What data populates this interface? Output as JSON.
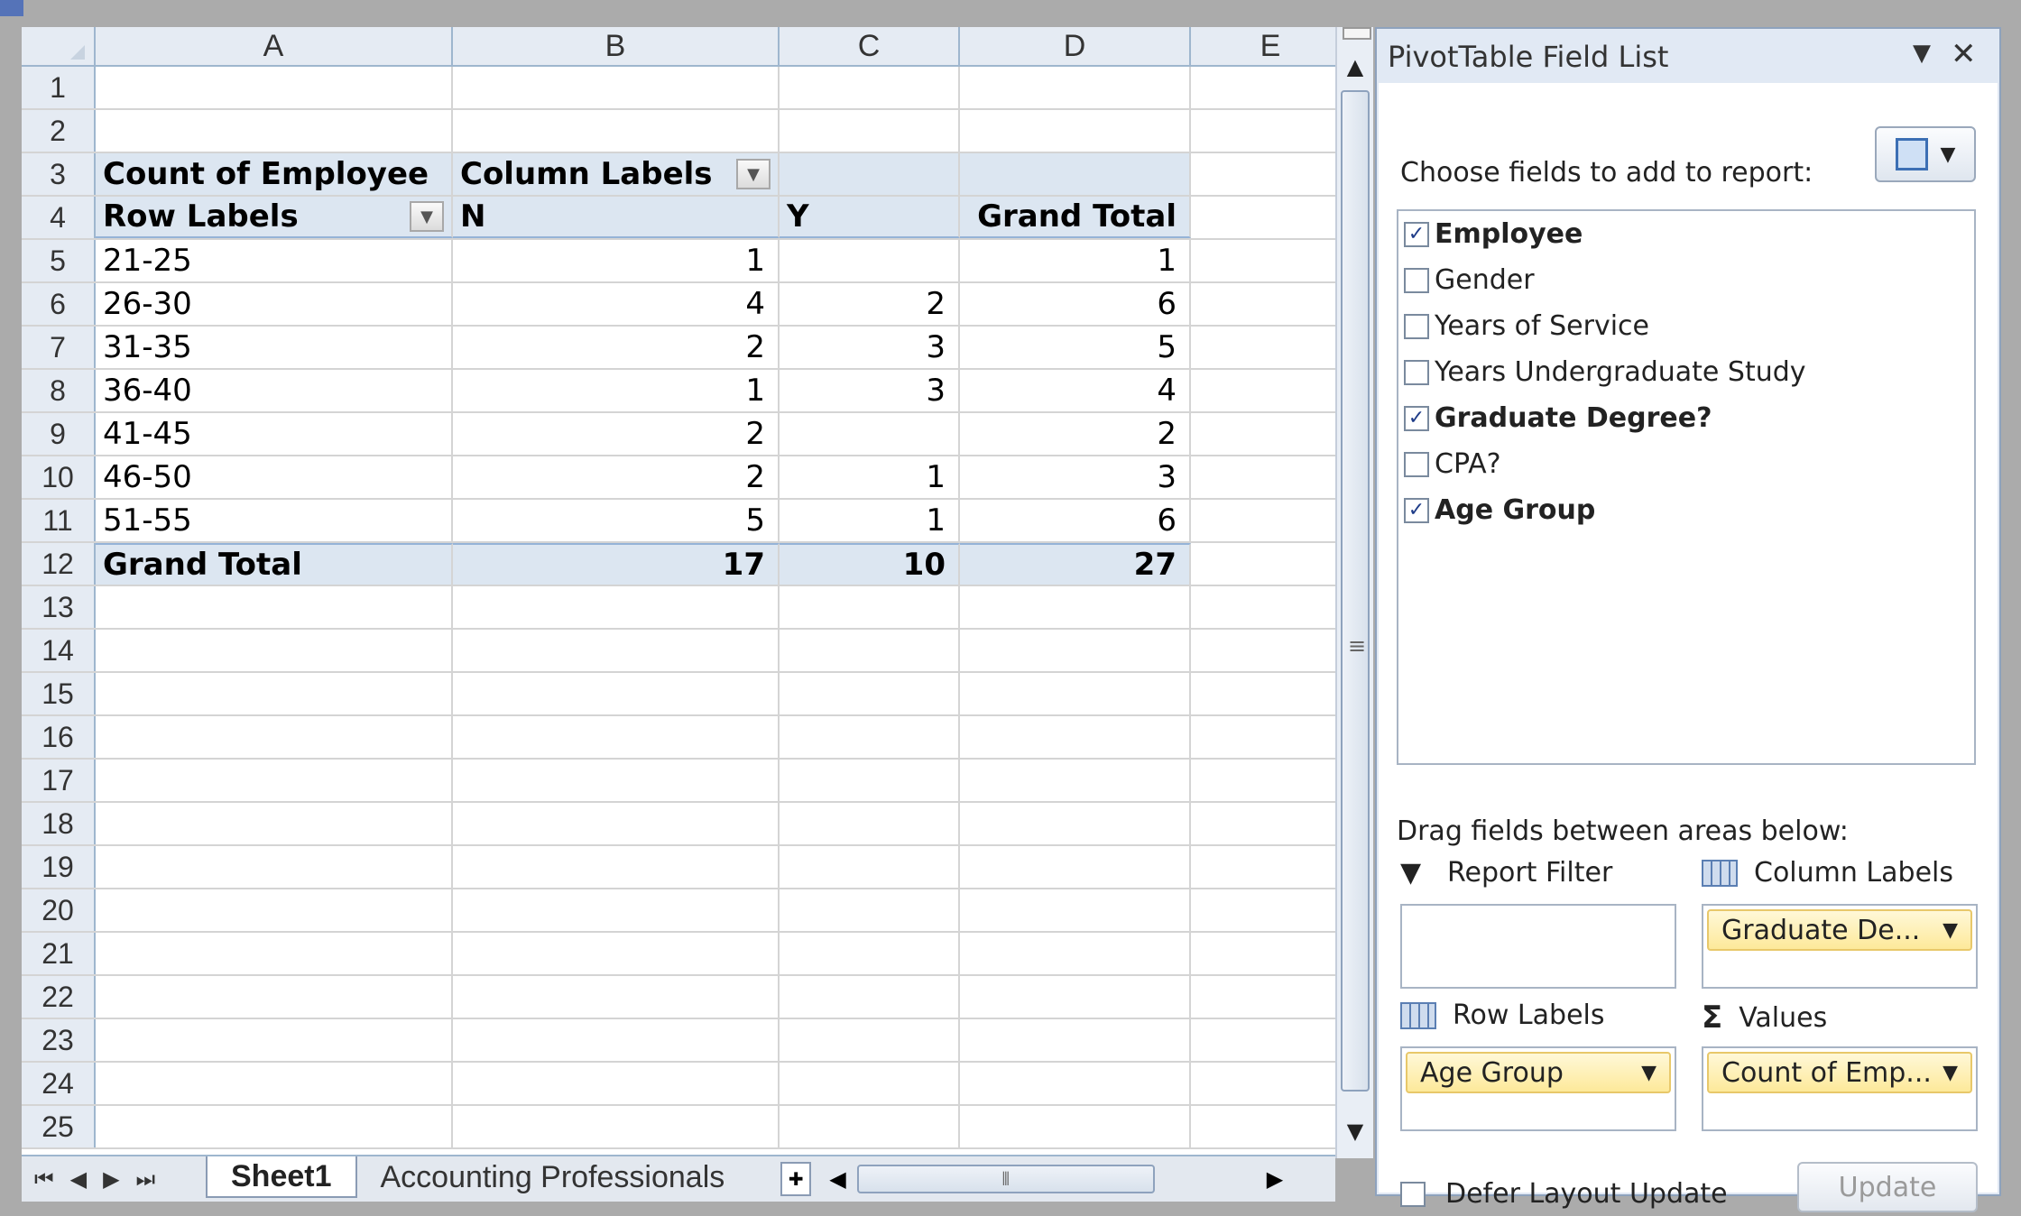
{
  "columns": [
    "A",
    "B",
    "C",
    "D",
    "E"
  ],
  "pivot": {
    "header_measure": "Count of Employee",
    "column_labels": "Column Labels",
    "row_labels": "Row Labels",
    "col_n": "N",
    "col_y": "Y",
    "grand_total_header": "Grand Total",
    "rows": [
      {
        "label": "21-25",
        "n": "1",
        "y": "",
        "total": "1"
      },
      {
        "label": "26-30",
        "n": "4",
        "y": "2",
        "total": "6"
      },
      {
        "label": "31-35",
        "n": "2",
        "y": "3",
        "total": "5"
      },
      {
        "label": "36-40",
        "n": "1",
        "y": "3",
        "total": "4"
      },
      {
        "label": "41-45",
        "n": "2",
        "y": "",
        "total": "2"
      },
      {
        "label": "46-50",
        "n": "2",
        "y": "1",
        "total": "3"
      },
      {
        "label": "51-55",
        "n": "5",
        "y": "1",
        "total": "6"
      }
    ],
    "grand_total": {
      "label": "Grand Total",
      "n": "17",
      "y": "10",
      "total": "27"
    }
  },
  "row_numbers": [
    "1",
    "2",
    "3",
    "4",
    "5",
    "6",
    "7",
    "8",
    "9",
    "10",
    "11",
    "12",
    "13",
    "14",
    "15",
    "16",
    "17",
    "18",
    "19",
    "20",
    "21",
    "22",
    "23",
    "24",
    "25"
  ],
  "tabs": {
    "nav_icons": [
      "first-sheet-icon",
      "prev-sheet-icon",
      "next-sheet-icon",
      "last-sheet-icon"
    ],
    "sheets": [
      "Sheet1",
      "Accounting Professionals"
    ],
    "active": "Sheet1"
  },
  "field_list": {
    "title": "PivotTable Field List",
    "choose_label": "Choose fields to add to report:",
    "fields": [
      {
        "label": "Employee",
        "checked": true
      },
      {
        "label": "Gender",
        "checked": false
      },
      {
        "label": "Years of Service",
        "checked": false
      },
      {
        "label": "Years Undergraduate Study",
        "checked": false
      },
      {
        "label": "Graduate Degree?",
        "checked": true
      },
      {
        "label": "CPA?",
        "checked": false
      },
      {
        "label": "Age Group",
        "checked": true
      }
    ],
    "drag_label": "Drag fields between areas below:",
    "areas": {
      "report_filter": {
        "label": "Report Filter",
        "pill": ""
      },
      "column_labels": {
        "label": "Column Labels",
        "pill": "Graduate De..."
      },
      "row_labels": {
        "label": "Row Labels",
        "pill": "Age Group"
      },
      "values": {
        "label": "Values",
        "pill": "Count of Emp..."
      }
    },
    "defer_label": "Defer Layout Update",
    "update_label": "Update"
  },
  "colors": {
    "pivot_fill": "#dce6f1",
    "header_fill": "#e5ebf3",
    "pane_fill": "#e1e9f4",
    "pill_fill": "#fde99a"
  }
}
